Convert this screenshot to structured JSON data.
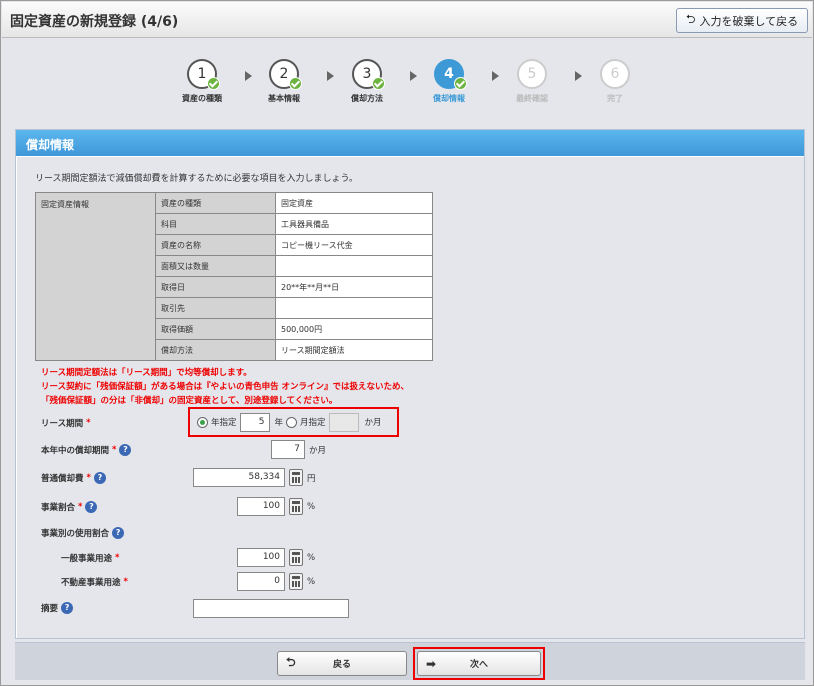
{
  "header": {
    "title": "固定資産の新規登録 (4/6)",
    "discard_button": "入力を破棄して戻る",
    "discard_icon": "return-arrow-icon"
  },
  "steps": [
    {
      "num": "1",
      "label": "資産の種類",
      "state": "done"
    },
    {
      "num": "2",
      "label": "基本情報",
      "state": "done"
    },
    {
      "num": "3",
      "label": "償却方法",
      "state": "done"
    },
    {
      "num": "4",
      "label": "償却情報",
      "state": "active"
    },
    {
      "num": "5",
      "label": "最終確認",
      "state": "todo"
    },
    {
      "num": "6",
      "label": "完了",
      "state": "todo"
    }
  ],
  "panel": {
    "title": "償却情報",
    "intro": "リース期間定額法で減価償却費を計算するために必要な項目を入力しましょう。"
  },
  "asset_info": {
    "group_label": "固定資産情報",
    "rows": [
      {
        "key": "資産の種類",
        "value": "固定資産"
      },
      {
        "key": "科目",
        "value": "工具器具備品"
      },
      {
        "key": "資産の名称",
        "value": "コピー機リース代金"
      },
      {
        "key": "面積又は数量",
        "value": ""
      },
      {
        "key": "取得日",
        "value": "20**年**月**日"
      },
      {
        "key": "取引先",
        "value": ""
      },
      {
        "key": "取得価額",
        "value": "500,000円"
      },
      {
        "key": "償却方法",
        "value": "リース期間定額法"
      }
    ]
  },
  "warning": {
    "line1": "リース期間定額法は「リース期間」で均等償却します。",
    "line2": "リース契約に「残価保証額」がある場合は『やよいの青色申告 オンライン』では扱えないため、",
    "line3": "「残価保証額」の分は「非償却」の固定資産として、別途登録してください。"
  },
  "form": {
    "lease_period": {
      "label": "リース期間",
      "required_mark": "*",
      "year_option": "年指定",
      "year_value": "5",
      "year_unit": "年",
      "month_option": "月指定",
      "month_value": "",
      "month_unit": "か月",
      "selected": "year"
    },
    "months_this_year": {
      "label": "本年中の償却期間",
      "required_mark": "*",
      "value": "7",
      "unit": "か月"
    },
    "normal_depreciation": {
      "label": "普通償却費",
      "required_mark": "*",
      "value": "58,334",
      "unit": "円"
    },
    "business_ratio": {
      "label": "事業割合",
      "required_mark": "*",
      "value": "100",
      "unit": "%"
    },
    "usage_ratio_label": "事業別の使用割合",
    "general_business": {
      "label": "一般事業用途",
      "required_mark": "*",
      "value": "100",
      "unit": "%"
    },
    "real_estate": {
      "label": "不動産事業用途",
      "required_mark": "*",
      "value": "0",
      "unit": "%"
    },
    "remarks": {
      "label": "摘要",
      "value": ""
    },
    "help_icon_glyph": "?"
  },
  "footer": {
    "back_button": "戻る",
    "back_icon": "return-arrow-icon",
    "next_button": "次へ",
    "next_icon": "right-arrow-icon"
  },
  "colors": {
    "accent": "#3d9ad6",
    "highlight": "#ee0000",
    "required": "#ee0000",
    "check": "#6cb43f"
  }
}
